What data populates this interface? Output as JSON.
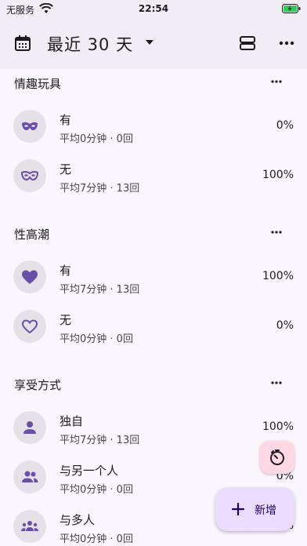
{
  "status_bar": {
    "carrier": "无服务",
    "time": "22:54"
  },
  "app_bar": {
    "title": "最近 30 天"
  },
  "sections": [
    {
      "label": "情趣玩具",
      "rows": [
        {
          "name": "有",
          "sub": "平均0分钟 · 0回",
          "pct": "0%",
          "icon": "mask-filled-icon"
        },
        {
          "name": "无",
          "sub": "平均7分钟 · 13回",
          "pct": "100%",
          "icon": "mask-outline-icon"
        }
      ]
    },
    {
      "label": "性高潮",
      "rows": [
        {
          "name": "有",
          "sub": "平均7分钟 · 13回",
          "pct": "100%",
          "icon": "heart-filled-icon"
        },
        {
          "name": "无",
          "sub": "平均0分钟 · 0回",
          "pct": "0%",
          "icon": "heart-outline-icon"
        }
      ]
    },
    {
      "label": "享受方式",
      "rows": [
        {
          "name": "独自",
          "sub": "平均7分钟 · 13回",
          "pct": "100%",
          "icon": "person-icon"
        },
        {
          "name": "与另一个人",
          "sub": "平均0分钟 · 0回",
          "pct": "0%",
          "icon": "two-people-icon"
        },
        {
          "name": "与多人",
          "sub": "平均0分钟 · 0回",
          "pct": "0%",
          "icon": "group-icon"
        }
      ]
    }
  ],
  "fab": {
    "add_label": "新增"
  },
  "colors": {
    "accent": "#6a4fa8",
    "avatar_bg": "#e6e0e9",
    "app_bar_bg": "#f2ecf4",
    "page_bg": "#fbf6fd",
    "timer_fab_bg": "#ffd8e4",
    "add_fab_bg": "#eaddff"
  }
}
